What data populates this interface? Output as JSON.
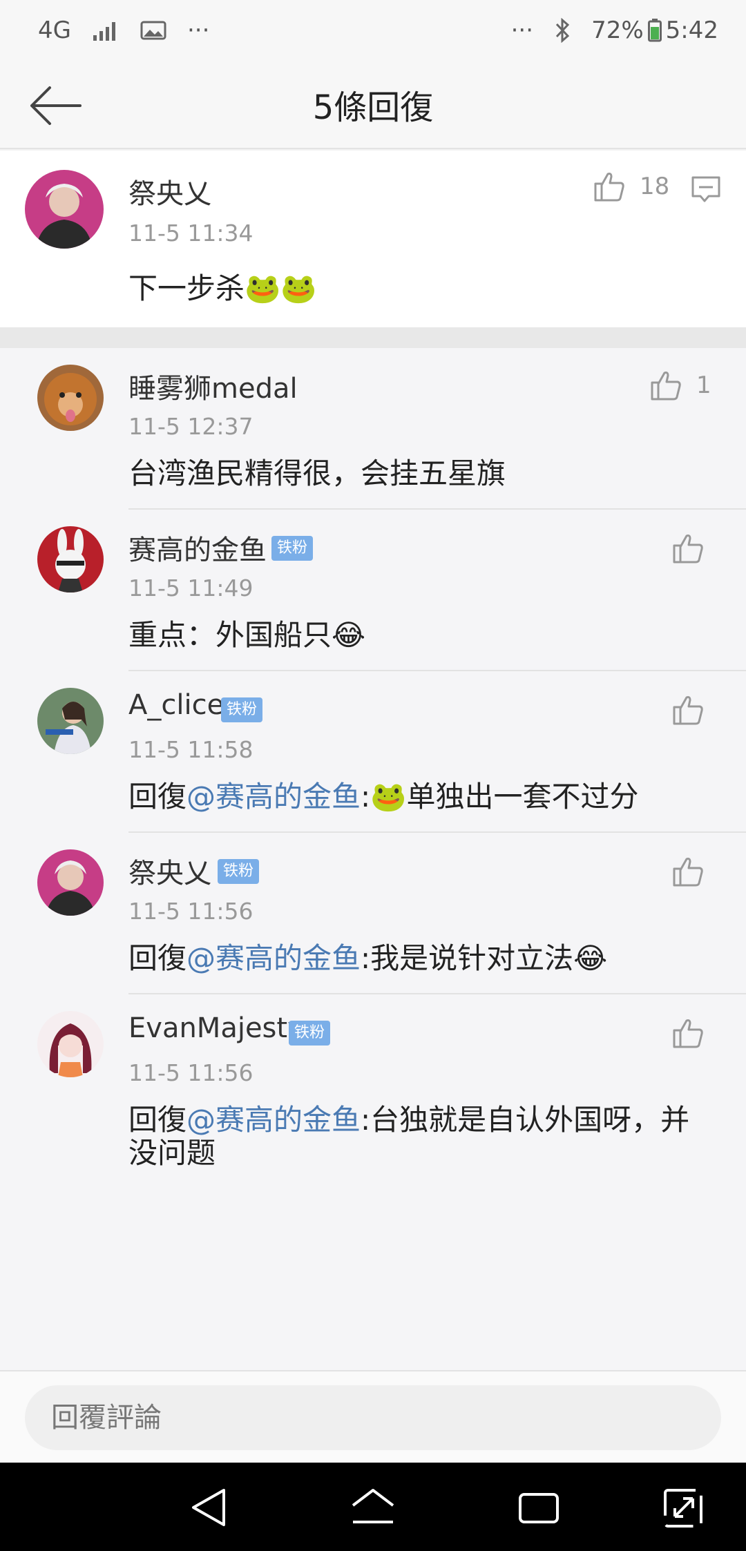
{
  "status_bar": {
    "network": "4G",
    "dots_left": "···",
    "dots_right": "···",
    "battery": "72%",
    "time": "5:42"
  },
  "header": {
    "title": "5條回復"
  },
  "main_comment": {
    "username": "祭央乂",
    "time": "11-5 11:34",
    "text": "下一步杀🐸🐸",
    "likes": "18"
  },
  "replies": [
    {
      "username": "睡雾狮medal",
      "badge": "",
      "time": "11-5 12:37",
      "prefix": "",
      "mention": "",
      "text": "台湾渔民精得很，会挂五星旗",
      "likes": "1"
    },
    {
      "username": "赛高的金鱼",
      "badge": "铁粉",
      "time": "11-5 11:49",
      "prefix": "",
      "mention": "",
      "text": "重点：外国船只😂",
      "likes": ""
    },
    {
      "username": "A_clice",
      "badge": "铁粉",
      "time": "11-5 11:58",
      "prefix": "回復",
      "mention": "@赛高的金鱼",
      "text": ":🐸单独出一套不过分",
      "likes": ""
    },
    {
      "username": "祭央乂",
      "badge": "铁粉",
      "time": "11-5 11:56",
      "prefix": "回復",
      "mention": "@赛高的金鱼",
      "text": ":我是说针对立法😂",
      "likes": ""
    },
    {
      "username": "EvanMajesty",
      "badge": "铁粉",
      "time": "11-5 11:56",
      "prefix": "回復",
      "mention": "@赛高的金鱼",
      "text": ":台独就是自认外国呀，并",
      "text2": "没问题",
      "likes": ""
    }
  ],
  "bottom": {
    "placeholder": "回覆評論"
  },
  "colors": {
    "mention": "#4a7ab3",
    "badge": "#7aaee8"
  }
}
